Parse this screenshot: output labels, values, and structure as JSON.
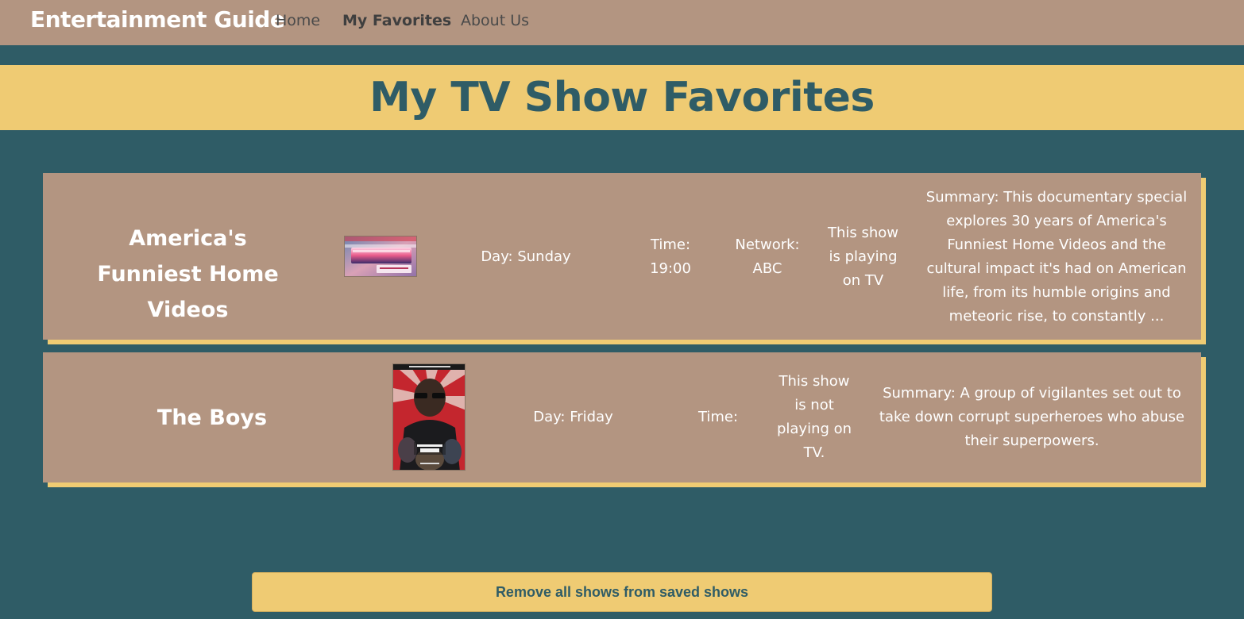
{
  "nav": {
    "brand": "Entertainment Guide",
    "links": [
      {
        "label": "Home"
      },
      {
        "label": "My Favorites",
        "active": true
      },
      {
        "label": "About Us"
      }
    ]
  },
  "page_title": "My TV Show Favorites",
  "shows": [
    {
      "title": "America's Funniest Home Videos",
      "thumbnail_icon": "afhv-poster",
      "day": "Day: Sunday",
      "time": "Time: 19:00",
      "network": "Network: ABC",
      "status": "This show is playing on TV",
      "summary": "Summary: This documentary special explores 30 years of America's Funniest Home Videos and the cultural impact it's had on American life, from its humble origins and meteoric rise, to constantly ..."
    },
    {
      "title": "The Boys",
      "thumbnail_icon": "the-boys-poster",
      "day": "Day: Friday",
      "time": "Time:",
      "status": "This show is not playing on TV.",
      "summary": "Summary: A group of vigilantes set out to take down corrupt superheroes who abuse their superpowers."
    }
  ],
  "remove_all_label": "Remove all shows from saved shows",
  "colors": {
    "background": "#2f5c66",
    "nav_background": "#b39581",
    "accent": "#efcb73",
    "card": "#b39581",
    "title_text": "#2f5c66"
  }
}
